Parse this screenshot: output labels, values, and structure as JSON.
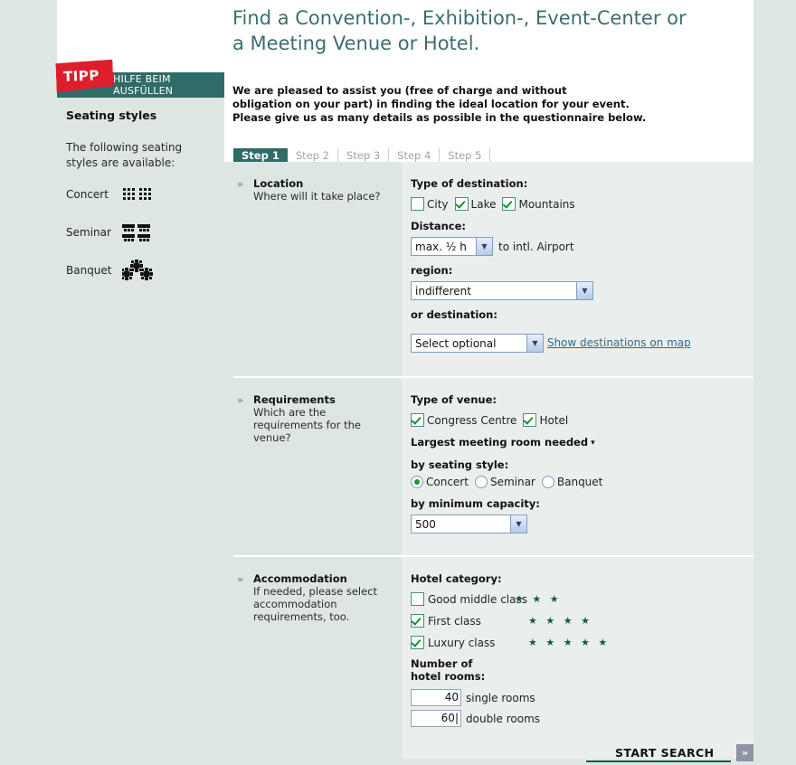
{
  "header": {
    "title_line1": "Find a Convention-, Exhibition-, Event-Center or",
    "title_line2": "a Meeting Venue or Hotel.",
    "intro": "We are pleased to assist you (free of charge and without\nobligation on your part) in finding the ideal location for your event.\nPlease give us as many details as possible in the questionnaire below."
  },
  "sidebar": {
    "badge": "TIPP",
    "badge_subtitle": "HILFE BEIM\nAUSFÜLLEN",
    "title": "Seating styles",
    "subtitle": "The following seating styles are available:",
    "seating": [
      {
        "label": "Concert",
        "icon": "concert-seating-icon"
      },
      {
        "label": "Seminar",
        "icon": "seminar-seating-icon"
      },
      {
        "label": "Banquet",
        "icon": "banquet-seating-icon"
      }
    ]
  },
  "tabs": [
    {
      "label": "Step 1",
      "active": true
    },
    {
      "label": "Step 2",
      "active": false
    },
    {
      "label": "Step 3",
      "active": false
    },
    {
      "label": "Step 4",
      "active": false
    },
    {
      "label": "Step 5",
      "active": false
    }
  ],
  "sections": {
    "location": {
      "arrow": "»",
      "title": "Location",
      "description": "Where will it take place?",
      "type_label": "Type of destination:",
      "types": [
        {
          "label": "City",
          "checked": false
        },
        {
          "label": "Lake",
          "checked": true
        },
        {
          "label": "Mountains",
          "checked": true
        }
      ],
      "distance_label": "Distance:",
      "distance_value": "max. ½ h",
      "distance_suffix": "to intl. Airport",
      "region_label": "region:",
      "region_value": "indifferent",
      "destination_label": "or destination:",
      "destination_value": "Select optional",
      "map_link": "Show destinations on map"
    },
    "requirements": {
      "arrow": "»",
      "title": "Requirements",
      "description": "Which are the requirements for the venue?",
      "venue_label": "Type of venue:",
      "venues": [
        {
          "label": "Congress Centre",
          "checked": true
        },
        {
          "label": "Hotel",
          "checked": true
        }
      ],
      "largest_room_label": "Largest meeting room needed",
      "largest_room_caret": "▾",
      "seating_style_label": "by seating style:",
      "seating_styles": [
        {
          "label": "Concert",
          "selected": true
        },
        {
          "label": "Seminar",
          "selected": false
        },
        {
          "label": "Banquet",
          "selected": false
        }
      ],
      "capacity_label": "by minimum capacity:",
      "capacity_value": "500"
    },
    "accommodation": {
      "arrow": "»",
      "title": "Accommodation",
      "description": "If needed, please select accommodation requirements, too.",
      "category_label": "Hotel category:",
      "categories": [
        {
          "label": "Good middle class",
          "checked": false,
          "stars": "★ ★ ★"
        },
        {
          "label": "First class",
          "checked": true,
          "stars": "★ ★ ★ ★"
        },
        {
          "label": "Luxury class",
          "checked": true,
          "stars": "★ ★ ★ ★ ★"
        }
      ],
      "rooms_label": "Number of hotel rooms:",
      "single_value": "40",
      "single_suffix": "single rooms",
      "double_value": "60",
      "double_suffix": "double rooms"
    }
  },
  "footer": {
    "start_label": "START SEARCH",
    "start_arrow": "»"
  },
  "colors": {
    "accent_teal": "#2f6b67",
    "badge_red": "#dd1f2d",
    "title_teal": "#3b6e70",
    "page_bg": "#dfe7e4",
    "panel_bg": "#dde6e2",
    "form_bg": "#eaefed",
    "link_blue": "#2f6b93"
  }
}
